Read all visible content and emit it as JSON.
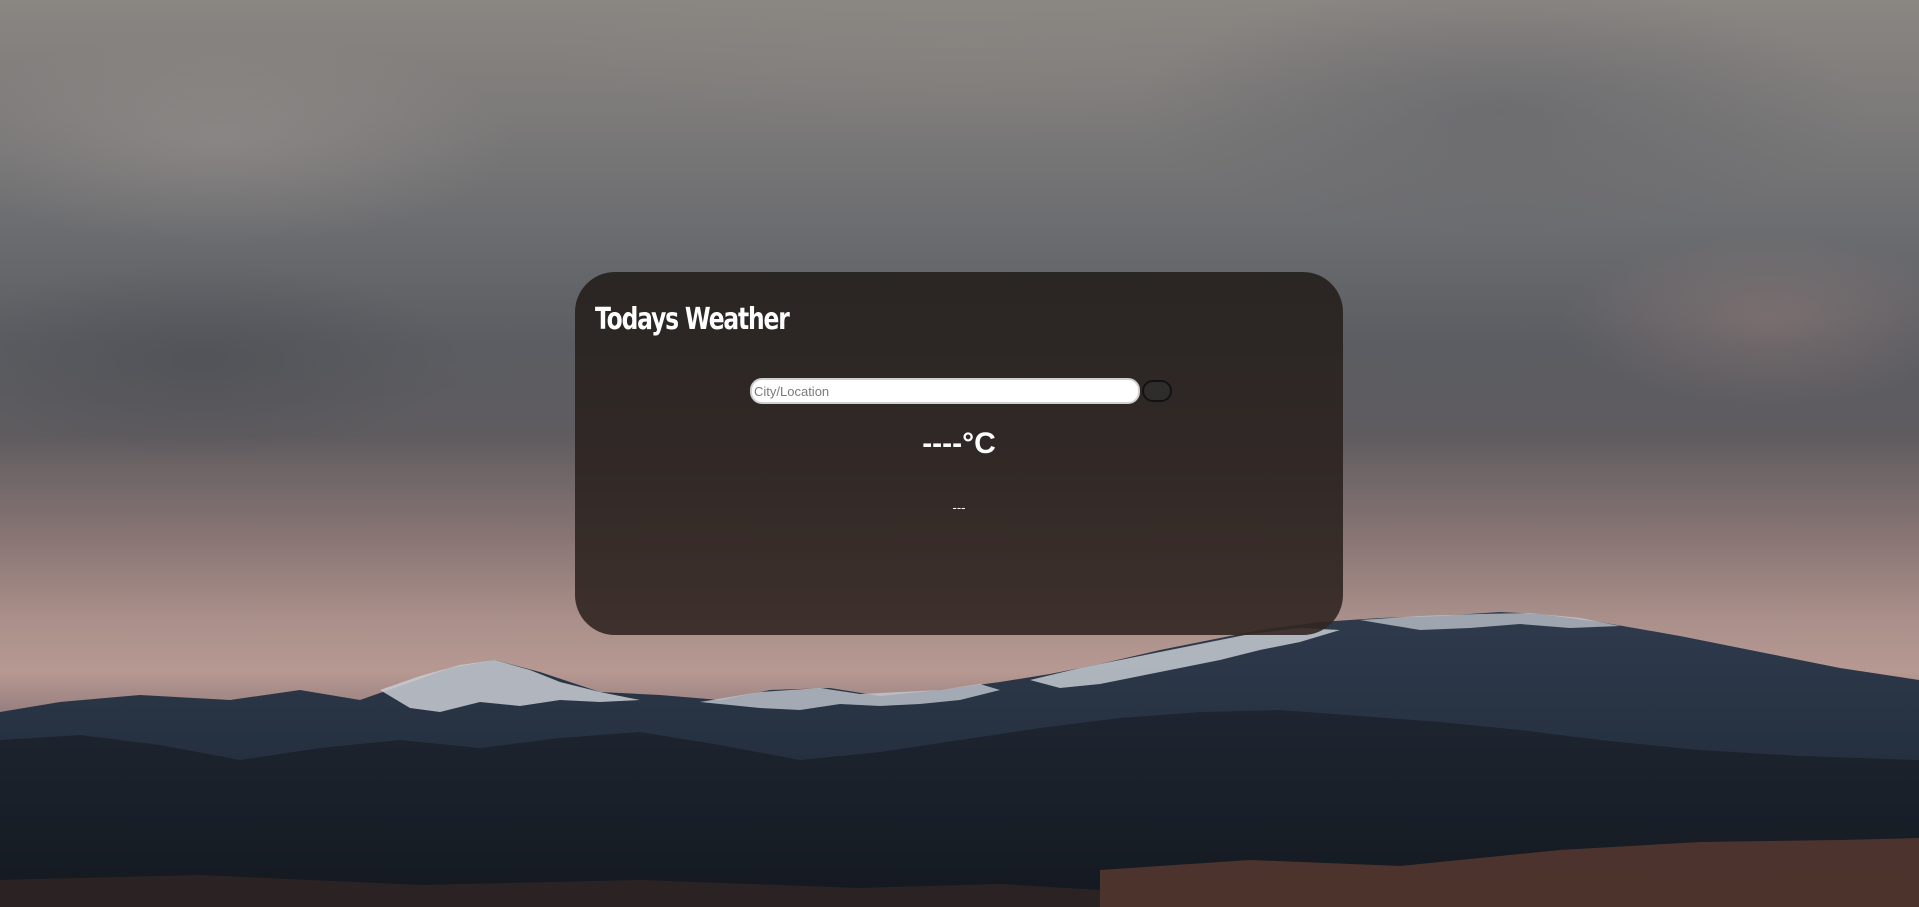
{
  "weather_card": {
    "title": "Todays Weather",
    "search": {
      "placeholder": "City/Location",
      "value": ""
    },
    "temperature": "----°C",
    "description": "---"
  }
}
